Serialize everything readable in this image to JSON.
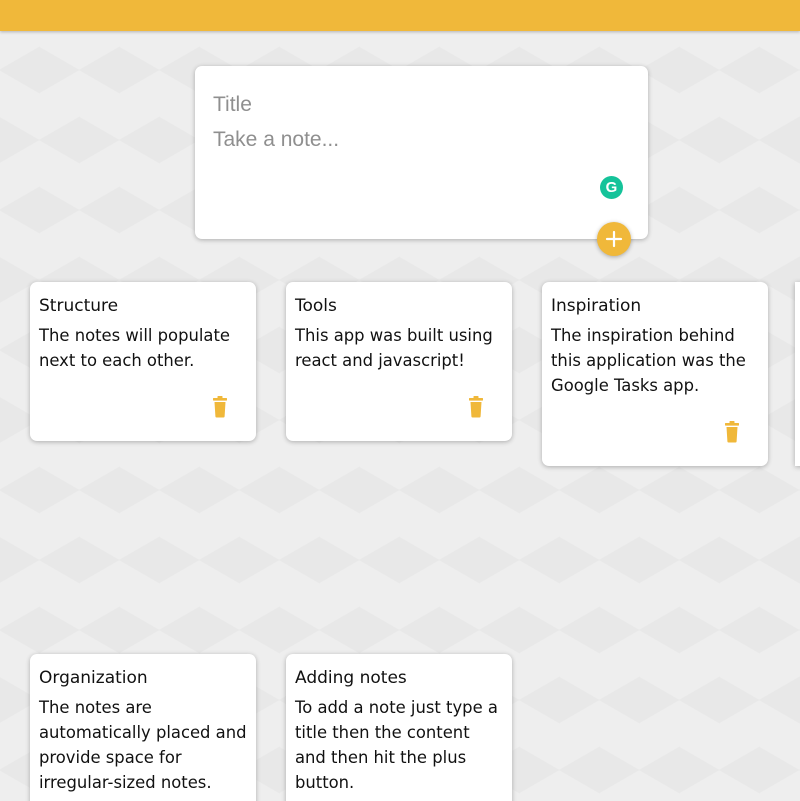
{
  "colors": {
    "accent": "#f0b83a",
    "background": "#eeeeee",
    "card": "#ffffff",
    "grammarly": "#15c39a"
  },
  "create_note": {
    "title_placeholder": "Title",
    "content_placeholder": "Take a note...",
    "grammarly_label": "G",
    "grammarly_icon": "grammarly-icon",
    "add_icon": "plus-icon"
  },
  "notes": [
    {
      "title": "Structure",
      "content": "The notes will populate next to each other.",
      "delete_icon": "trash-icon"
    },
    {
      "title": "Tools",
      "content": "This app was built using react and javascript!",
      "delete_icon": "trash-icon"
    },
    {
      "title": "Inspiration",
      "content": "The inspiration behind this application was the Google Tasks app.",
      "delete_icon": "trash-icon"
    },
    {
      "title": "Organization",
      "content": "The notes are automatically placed and provide space for irregular-sized notes.",
      "delete_icon": "trash-icon"
    },
    {
      "title": "Adding notes",
      "content": "To add a note just type a title then the content and then hit the plus button.",
      "delete_icon": "trash-icon"
    }
  ]
}
